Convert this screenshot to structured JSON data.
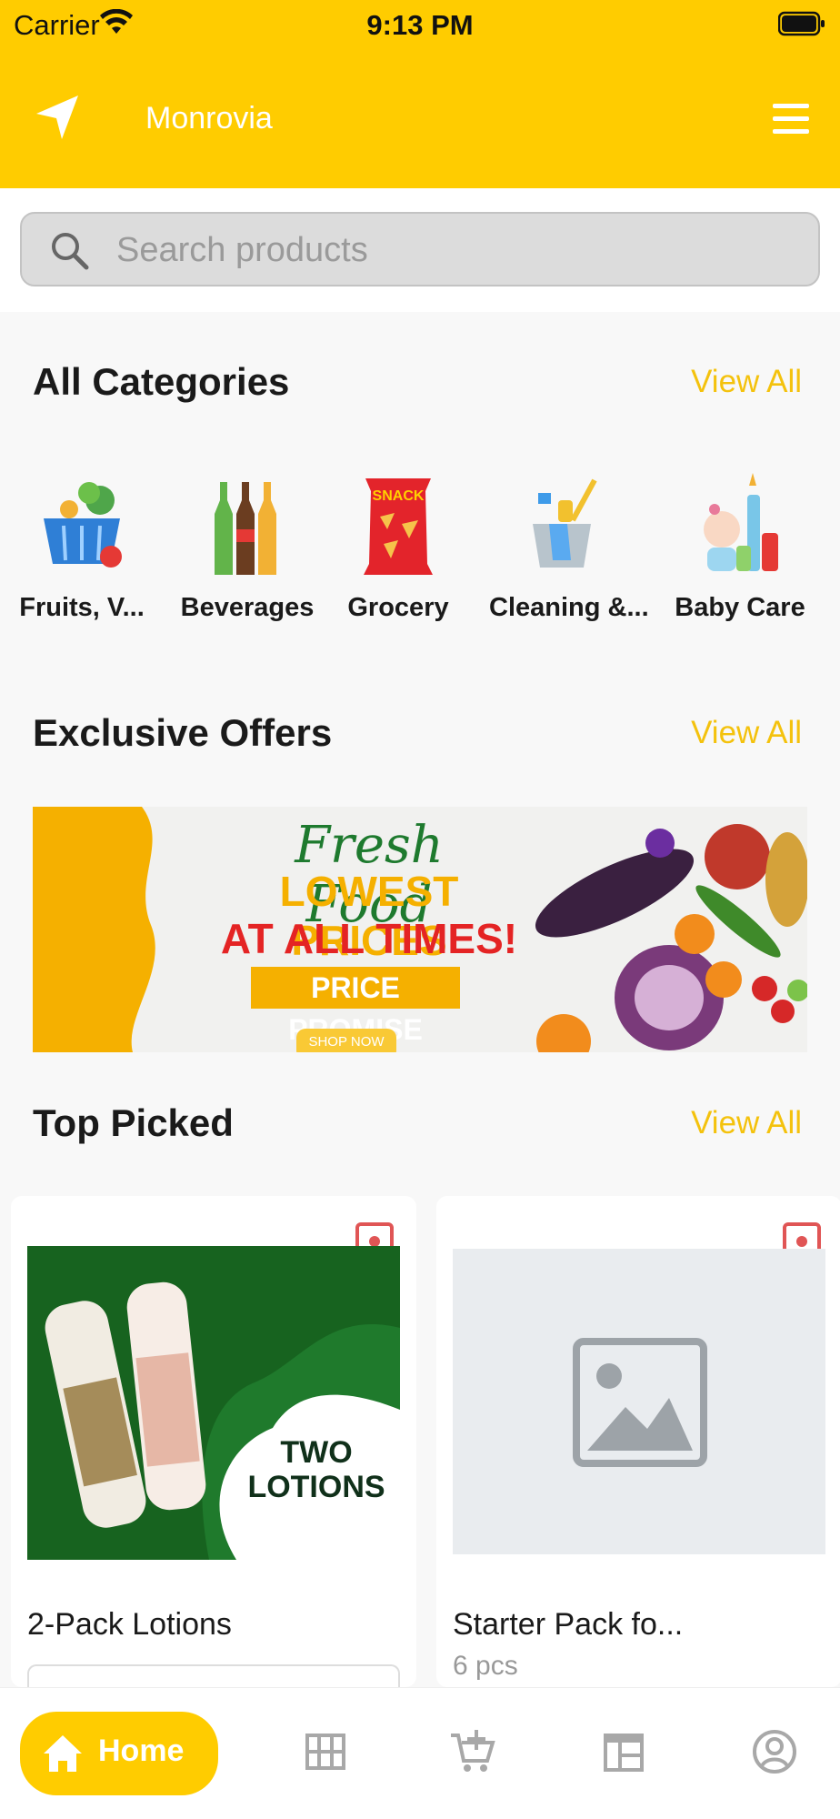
{
  "status_bar": {
    "carrier": "Carrier",
    "time": "9:13 PM"
  },
  "header": {
    "city": "Monrovia"
  },
  "search": {
    "placeholder": "Search products"
  },
  "categories_section": {
    "title": "All Categories",
    "view_all": "View All",
    "items": [
      {
        "label": "Fruits,  V...",
        "icon": "basket-icon"
      },
      {
        "label": "Beverages",
        "icon": "bottles-icon"
      },
      {
        "label": "Grocery",
        "icon": "snack-icon"
      },
      {
        "label": "Cleaning &...",
        "icon": "cleaning-icon"
      },
      {
        "label": "Baby Care",
        "icon": "baby-icon"
      }
    ]
  },
  "offers_section": {
    "title": "Exclusive Offers",
    "view_all": "View All",
    "banner": {
      "line1": "Fresh Food",
      "line2": "LOWEST PRICES",
      "line3": "AT ALL TIMES!",
      "badge": "PRICE PROMISE",
      "cta": "SHOP NOW"
    }
  },
  "top_picked": {
    "title": "Top Picked",
    "view_all": "View All",
    "products": [
      {
        "title": "2-Pack Lotions",
        "subtitle": "",
        "image_text": "TWO\nLOTIONS"
      },
      {
        "title": "Starter Pack fo...",
        "subtitle": "6 pcs"
      }
    ]
  },
  "bottom_nav": {
    "home_label": "Home",
    "items": [
      "home-icon",
      "grid-icon",
      "cart-add-icon",
      "orders-icon",
      "profile-icon"
    ]
  },
  "colors": {
    "brand_yellow": "#ffcc00",
    "view_all": "#f4c20d",
    "fav_red": "#e05555"
  }
}
